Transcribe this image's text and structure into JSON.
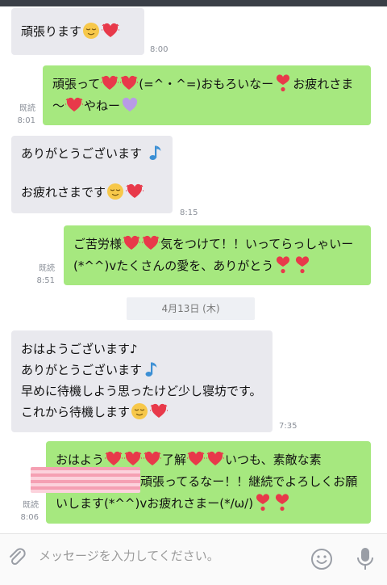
{
  "messages": [
    {
      "side": "in",
      "lines": [
        [
          {
            "t": "頑張ります"
          },
          {
            "e": "relieved-face"
          },
          {
            "e": "heart"
          }
        ]
      ],
      "time": "8:00",
      "read": ""
    },
    {
      "side": "out",
      "lines": [
        [
          {
            "t": "頑張って"
          },
          {
            "e": "heart"
          },
          {
            "e": "heart"
          },
          {
            "t": "(=^・^=)おもろいなー"
          },
          {
            "e": "heart-exclamation"
          },
          {
            "t": "お疲れさま"
          }
        ],
        [
          {
            "t": "〜"
          },
          {
            "e": "heart"
          },
          {
            "t": "やねー"
          },
          {
            "e": "purple-heart"
          }
        ]
      ],
      "time": "8:01",
      "read": "既読"
    },
    {
      "side": "in",
      "lines": [
        [
          {
            "t": "ありがとうございます "
          },
          {
            "e": "musical-note"
          }
        ],
        [],
        [
          {
            "t": "お疲れさまです"
          },
          {
            "e": "relieved-face"
          },
          {
            "e": "heart"
          }
        ]
      ],
      "time": "8:15",
      "read": ""
    },
    {
      "side": "out",
      "lines": [
        [
          {
            "t": "ご苦労様"
          },
          {
            "e": "heart"
          },
          {
            "e": "heart"
          },
          {
            "t": "気をつけて！！いってらっしゃいー"
          }
        ],
        [
          {
            "t": "(*^^)vたくさんの愛を、ありがとう"
          },
          {
            "e": "heart-exclamation"
          },
          {
            "e": "heart-exclamation"
          }
        ]
      ],
      "time": "8:51",
      "read": "既読"
    },
    {
      "side": "in",
      "lines": [
        [
          {
            "t": "おはようございます♪"
          }
        ],
        [
          {
            "t": "ありがとうございます"
          },
          {
            "e": "musical-note"
          }
        ],
        [
          {
            "t": "早めに待機しよう思ったけど少し寝坊です。"
          }
        ],
        [
          {
            "t": "これから待機します"
          },
          {
            "e": "relieved-face"
          },
          {
            "e": "heart"
          }
        ]
      ],
      "time": "7:35",
      "read": ""
    },
    {
      "side": "out",
      "lines": [
        [
          {
            "t": "おはよう"
          },
          {
            "e": "heart"
          },
          {
            "e": "heart"
          },
          {
            "e": "heart"
          },
          {
            "t": "了解"
          },
          {
            "e": "heart"
          },
          {
            "e": "heart"
          },
          {
            "t": "いつも、素敵な素"
          }
        ],
        [
          {
            "t": "　　　　　　　頑張ってるなー！！継続でよろしくお願"
          }
        ],
        [
          {
            "t": "いします(*^^)vお疲れさまー(*/ω/)"
          },
          {
            "e": "heart-exclamation"
          },
          {
            "e": "heart-exclamation"
          }
        ]
      ],
      "time": "8:06",
      "read": "既読"
    }
  ],
  "date_separator": "4月13日 (木)",
  "composer": {
    "placeholder": "メッセージを入力してください。",
    "attach_icon": "paperclip-icon",
    "emoji_icon": "smiley-icon",
    "mic_icon": "microphone-icon"
  },
  "colors": {
    "incoming_bubble": "#e9e9ee",
    "outgoing_bubble": "#a6e87f",
    "meta_text": "#8a8f98",
    "heart": "#e8394a",
    "purple_heart": "#b89be6",
    "note": "#3b8fd4",
    "face": "#f7c84a"
  }
}
